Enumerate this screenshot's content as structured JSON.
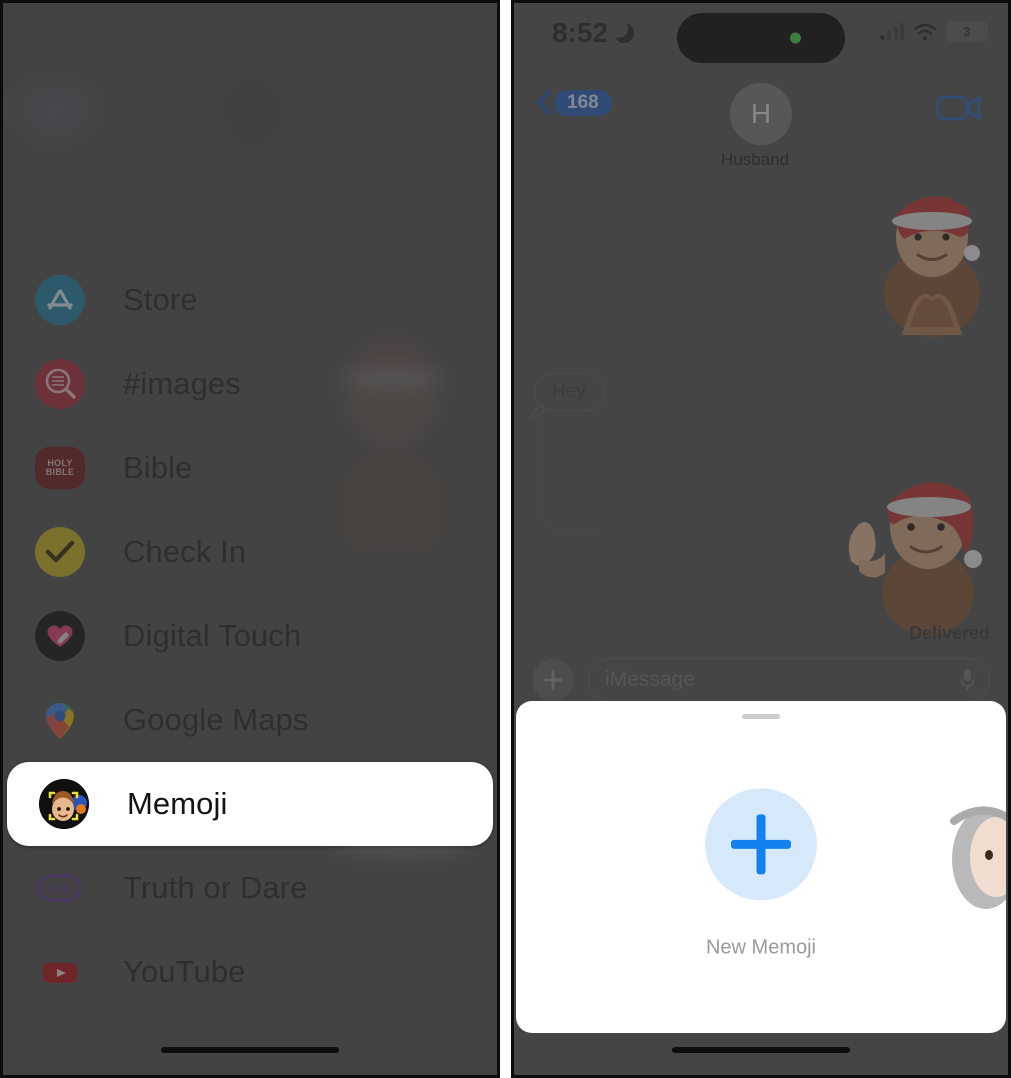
{
  "left_phone": {
    "name": "imessage-app-drawer",
    "apps": [
      {
        "label": "Store",
        "icon": "app-store-icon",
        "selected": false
      },
      {
        "label": "#images",
        "icon": "images-search-icon",
        "selected": false
      },
      {
        "label": "Bible",
        "icon": "holy-bible-icon",
        "selected": false,
        "icon_text": "HOLY BIBLE"
      },
      {
        "label": "Check In",
        "icon": "check-in-icon",
        "selected": false
      },
      {
        "label": "Digital Touch",
        "icon": "digital-touch-icon",
        "selected": false
      },
      {
        "label": "Google Maps",
        "icon": "google-maps-icon",
        "selected": false
      },
      {
        "label": "Memoji",
        "icon": "memoji-icon",
        "selected": true
      },
      {
        "label": "Truth or Dare",
        "icon": "truth-or-dare-icon",
        "selected": false,
        "icon_text": "T&D"
      },
      {
        "label": "YouTube",
        "icon": "youtube-icon",
        "selected": false
      }
    ]
  },
  "right_phone": {
    "status_bar": {
      "time": "8:52",
      "moon_icon": "crescent-moon-icon",
      "cellular_icon": "cellular-bars-icon",
      "wifi_icon": "wifi-icon",
      "battery_level": "3"
    },
    "nav_bar": {
      "back_icon": "chevron-left-icon",
      "unread_count": "168",
      "avatar_initial": "H",
      "contact_name": "Husband",
      "contact_chevron_icon": "chevron-down-icon",
      "facetime_icon": "video-camera-icon"
    },
    "thread": {
      "incoming_message": "Hey",
      "sticker_1": "memoji-santa-heart-hands-sticker",
      "sticker_2": "memoji-santa-thumbs-up-sticker",
      "delivery_status": "Delivered"
    },
    "composer": {
      "plus_icon": "plus-icon",
      "placeholder": "iMessage",
      "value": "",
      "mic_icon": "microphone-icon"
    },
    "sheet": {
      "grabber_icon": "sheet-grabber-handle",
      "new_memoji_icon": "plus-icon",
      "new_memoji_label": "New Memoji",
      "edge_memoji": "memoji-gray-hair-partial"
    }
  },
  "colors": {
    "accent_blue": "#1581f1",
    "badge_blue": "#1f56ad",
    "sheet_white": "#ffffff",
    "dim_gray": "#4d4d4d",
    "new_memoji_circle": "#d6e9fb",
    "status_green": "#3cc13b"
  }
}
